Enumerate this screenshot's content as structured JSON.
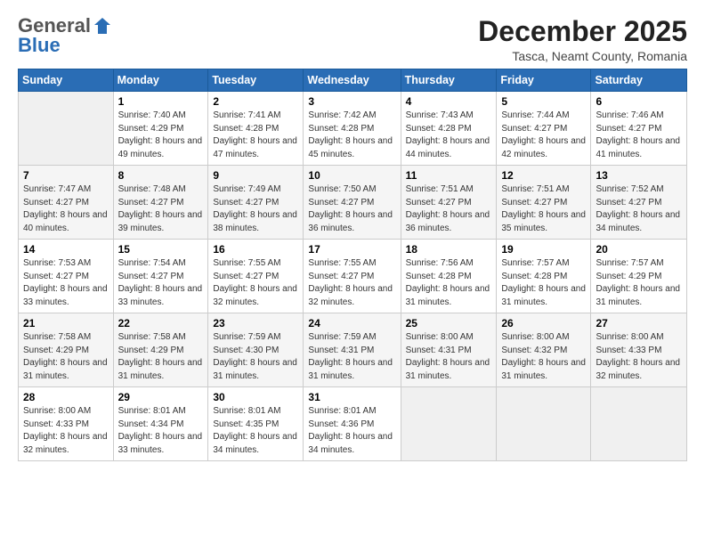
{
  "logo": {
    "general": "General",
    "blue": "Blue"
  },
  "header": {
    "month": "December 2025",
    "location": "Tasca, Neamt County, Romania"
  },
  "days_of_week": [
    "Sunday",
    "Monday",
    "Tuesday",
    "Wednesday",
    "Thursday",
    "Friday",
    "Saturday"
  ],
  "weeks": [
    [
      {
        "day": "",
        "sunrise": "",
        "sunset": "",
        "daylight": ""
      },
      {
        "day": "1",
        "sunrise": "Sunrise: 7:40 AM",
        "sunset": "Sunset: 4:29 PM",
        "daylight": "Daylight: 8 hours and 49 minutes."
      },
      {
        "day": "2",
        "sunrise": "Sunrise: 7:41 AM",
        "sunset": "Sunset: 4:28 PM",
        "daylight": "Daylight: 8 hours and 47 minutes."
      },
      {
        "day": "3",
        "sunrise": "Sunrise: 7:42 AM",
        "sunset": "Sunset: 4:28 PM",
        "daylight": "Daylight: 8 hours and 45 minutes."
      },
      {
        "day": "4",
        "sunrise": "Sunrise: 7:43 AM",
        "sunset": "Sunset: 4:28 PM",
        "daylight": "Daylight: 8 hours and 44 minutes."
      },
      {
        "day": "5",
        "sunrise": "Sunrise: 7:44 AM",
        "sunset": "Sunset: 4:27 PM",
        "daylight": "Daylight: 8 hours and 42 minutes."
      },
      {
        "day": "6",
        "sunrise": "Sunrise: 7:46 AM",
        "sunset": "Sunset: 4:27 PM",
        "daylight": "Daylight: 8 hours and 41 minutes."
      }
    ],
    [
      {
        "day": "7",
        "sunrise": "Sunrise: 7:47 AM",
        "sunset": "Sunset: 4:27 PM",
        "daylight": "Daylight: 8 hours and 40 minutes."
      },
      {
        "day": "8",
        "sunrise": "Sunrise: 7:48 AM",
        "sunset": "Sunset: 4:27 PM",
        "daylight": "Daylight: 8 hours and 39 minutes."
      },
      {
        "day": "9",
        "sunrise": "Sunrise: 7:49 AM",
        "sunset": "Sunset: 4:27 PM",
        "daylight": "Daylight: 8 hours and 38 minutes."
      },
      {
        "day": "10",
        "sunrise": "Sunrise: 7:50 AM",
        "sunset": "Sunset: 4:27 PM",
        "daylight": "Daylight: 8 hours and 36 minutes."
      },
      {
        "day": "11",
        "sunrise": "Sunrise: 7:51 AM",
        "sunset": "Sunset: 4:27 PM",
        "daylight": "Daylight: 8 hours and 36 minutes."
      },
      {
        "day": "12",
        "sunrise": "Sunrise: 7:51 AM",
        "sunset": "Sunset: 4:27 PM",
        "daylight": "Daylight: 8 hours and 35 minutes."
      },
      {
        "day": "13",
        "sunrise": "Sunrise: 7:52 AM",
        "sunset": "Sunset: 4:27 PM",
        "daylight": "Daylight: 8 hours and 34 minutes."
      }
    ],
    [
      {
        "day": "14",
        "sunrise": "Sunrise: 7:53 AM",
        "sunset": "Sunset: 4:27 PM",
        "daylight": "Daylight: 8 hours and 33 minutes."
      },
      {
        "day": "15",
        "sunrise": "Sunrise: 7:54 AM",
        "sunset": "Sunset: 4:27 PM",
        "daylight": "Daylight: 8 hours and 33 minutes."
      },
      {
        "day": "16",
        "sunrise": "Sunrise: 7:55 AM",
        "sunset": "Sunset: 4:27 PM",
        "daylight": "Daylight: 8 hours and 32 minutes."
      },
      {
        "day": "17",
        "sunrise": "Sunrise: 7:55 AM",
        "sunset": "Sunset: 4:27 PM",
        "daylight": "Daylight: 8 hours and 32 minutes."
      },
      {
        "day": "18",
        "sunrise": "Sunrise: 7:56 AM",
        "sunset": "Sunset: 4:28 PM",
        "daylight": "Daylight: 8 hours and 31 minutes."
      },
      {
        "day": "19",
        "sunrise": "Sunrise: 7:57 AM",
        "sunset": "Sunset: 4:28 PM",
        "daylight": "Daylight: 8 hours and 31 minutes."
      },
      {
        "day": "20",
        "sunrise": "Sunrise: 7:57 AM",
        "sunset": "Sunset: 4:29 PM",
        "daylight": "Daylight: 8 hours and 31 minutes."
      }
    ],
    [
      {
        "day": "21",
        "sunrise": "Sunrise: 7:58 AM",
        "sunset": "Sunset: 4:29 PM",
        "daylight": "Daylight: 8 hours and 31 minutes."
      },
      {
        "day": "22",
        "sunrise": "Sunrise: 7:58 AM",
        "sunset": "Sunset: 4:29 PM",
        "daylight": "Daylight: 8 hours and 31 minutes."
      },
      {
        "day": "23",
        "sunrise": "Sunrise: 7:59 AM",
        "sunset": "Sunset: 4:30 PM",
        "daylight": "Daylight: 8 hours and 31 minutes."
      },
      {
        "day": "24",
        "sunrise": "Sunrise: 7:59 AM",
        "sunset": "Sunset: 4:31 PM",
        "daylight": "Daylight: 8 hours and 31 minutes."
      },
      {
        "day": "25",
        "sunrise": "Sunrise: 8:00 AM",
        "sunset": "Sunset: 4:31 PM",
        "daylight": "Daylight: 8 hours and 31 minutes."
      },
      {
        "day": "26",
        "sunrise": "Sunrise: 8:00 AM",
        "sunset": "Sunset: 4:32 PM",
        "daylight": "Daylight: 8 hours and 31 minutes."
      },
      {
        "day": "27",
        "sunrise": "Sunrise: 8:00 AM",
        "sunset": "Sunset: 4:33 PM",
        "daylight": "Daylight: 8 hours and 32 minutes."
      }
    ],
    [
      {
        "day": "28",
        "sunrise": "Sunrise: 8:00 AM",
        "sunset": "Sunset: 4:33 PM",
        "daylight": "Daylight: 8 hours and 32 minutes."
      },
      {
        "day": "29",
        "sunrise": "Sunrise: 8:01 AM",
        "sunset": "Sunset: 4:34 PM",
        "daylight": "Daylight: 8 hours and 33 minutes."
      },
      {
        "day": "30",
        "sunrise": "Sunrise: 8:01 AM",
        "sunset": "Sunset: 4:35 PM",
        "daylight": "Daylight: 8 hours and 34 minutes."
      },
      {
        "day": "31",
        "sunrise": "Sunrise: 8:01 AM",
        "sunset": "Sunset: 4:36 PM",
        "daylight": "Daylight: 8 hours and 34 minutes."
      },
      {
        "day": "",
        "sunrise": "",
        "sunset": "",
        "daylight": ""
      },
      {
        "day": "",
        "sunrise": "",
        "sunset": "",
        "daylight": ""
      },
      {
        "day": "",
        "sunrise": "",
        "sunset": "",
        "daylight": ""
      }
    ]
  ]
}
